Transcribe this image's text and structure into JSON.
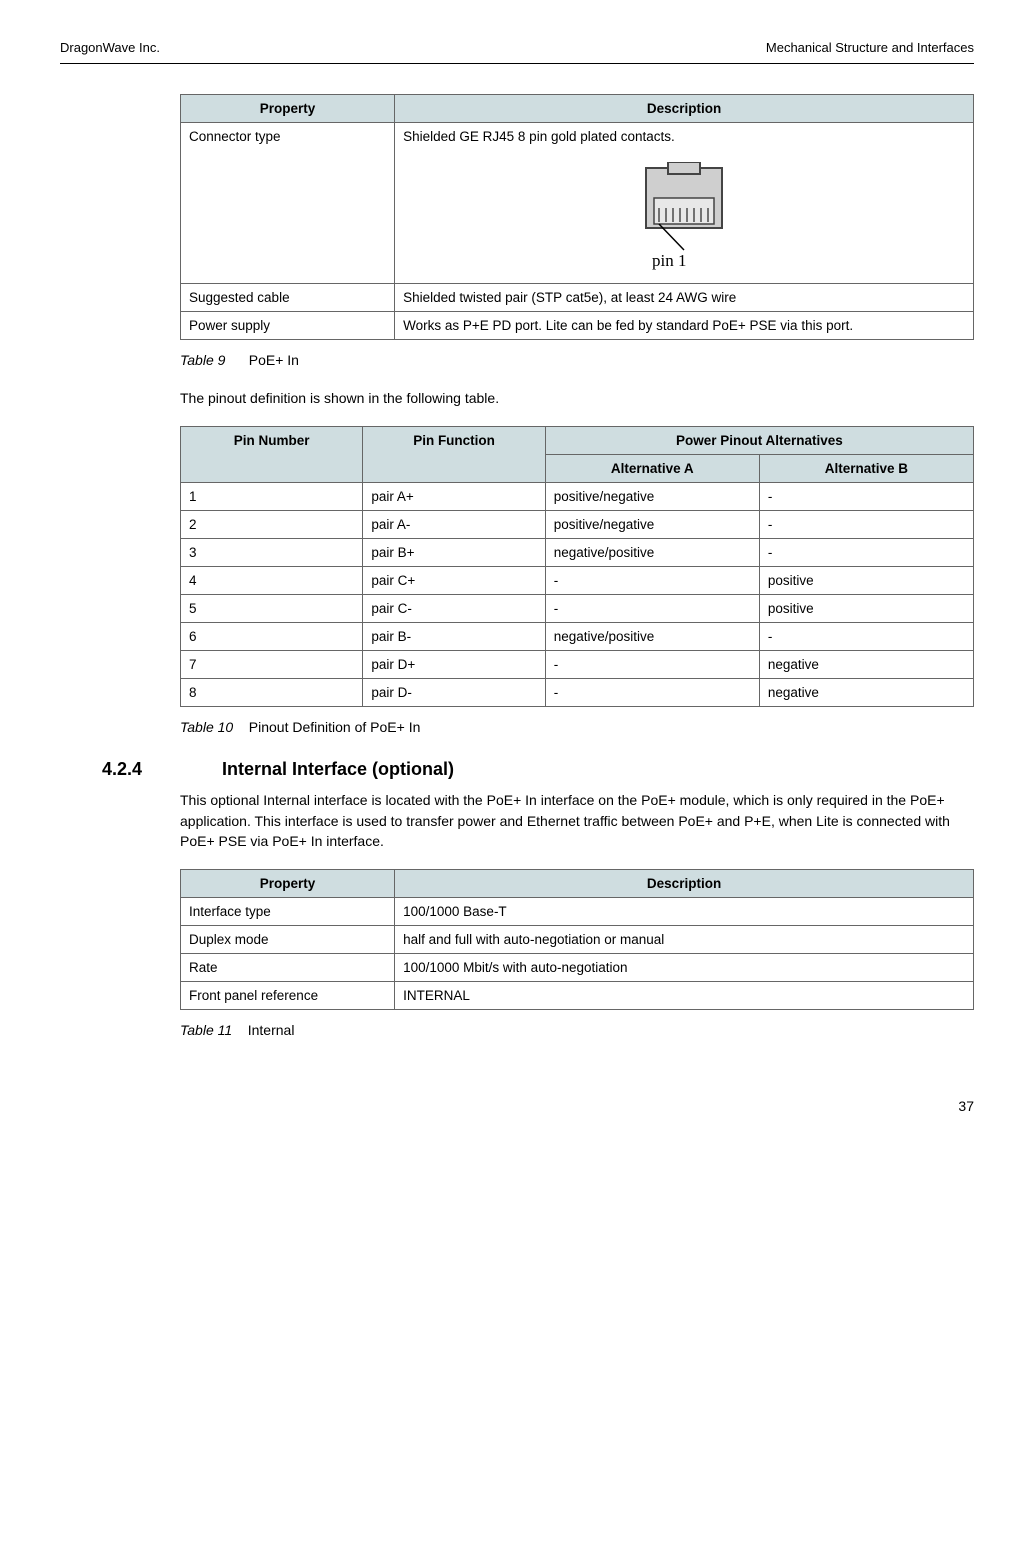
{
  "header": {
    "left": "DragonWave Inc.",
    "right": "Mechanical Structure and Interfaces"
  },
  "table9": {
    "headers": {
      "property": "Property",
      "description": "Description"
    },
    "rows": [
      {
        "property": "Connector type",
        "description": "Shielded GE RJ45 8 pin gold plated contacts."
      },
      {
        "property": "Suggested cable",
        "description": "Shielded twisted pair (STP cat5e), at least 24 AWG wire"
      },
      {
        "property": "Power supply",
        "description": "Works as P+E PD port. Lite can be fed by standard PoE+ PSE via this port."
      }
    ],
    "caption_label": "Table 9",
    "caption_text": "PoE+ In",
    "pin1_label": "pin 1"
  },
  "paragraph1": "The pinout definition is shown in the following table.",
  "table10": {
    "headers": {
      "pin_number": "Pin Number",
      "pin_function": "Pin Function",
      "power_alt": "Power Pinout Alternatives",
      "alt_a": "Alternative A",
      "alt_b": "Alternative B"
    },
    "rows": [
      {
        "pin": "1",
        "func": "pair A+",
        "a": "positive/negative",
        "b": "-"
      },
      {
        "pin": "2",
        "func": "pair A-",
        "a": "positive/negative",
        "b": "-"
      },
      {
        "pin": "3",
        "func": "pair B+",
        "a": "negative/positive",
        "b": "-"
      },
      {
        "pin": "4",
        "func": "pair C+",
        "a": "-",
        "b": "positive"
      },
      {
        "pin": "5",
        "func": "pair C-",
        "a": "-",
        "b": "positive"
      },
      {
        "pin": "6",
        "func": "pair B-",
        "a": "negative/positive",
        "b": "-"
      },
      {
        "pin": "7",
        "func": "pair D+",
        "a": "-",
        "b": "negative"
      },
      {
        "pin": "8",
        "func": "pair D-",
        "a": "-",
        "b": "negative"
      }
    ],
    "caption_label": "Table 10",
    "caption_text": "Pinout Definition of PoE+ In"
  },
  "section": {
    "number": "4.2.4",
    "title": "Internal Interface (optional)"
  },
  "paragraph2": "This optional Internal interface is located with the PoE+ In interface on the PoE+ module, which is only required in the PoE+ application. This interface is used to transfer power and Ethernet traffic between PoE+ and P+E, when Lite is connected with PoE+ PSE via PoE+ In interface.",
  "table11": {
    "headers": {
      "property": "Property",
      "description": "Description"
    },
    "rows": [
      {
        "property": "Interface type",
        "description": "100/1000 Base-T"
      },
      {
        "property": "Duplex mode",
        "description": "half and full with auto-negotiation or manual"
      },
      {
        "property": "Rate",
        "description": "100/1000 Mbit/s with auto-negotiation"
      },
      {
        "property": "Front panel reference",
        "description": "INTERNAL"
      }
    ],
    "caption_label": "Table 11",
    "caption_text": "Internal"
  },
  "page_number": "37"
}
